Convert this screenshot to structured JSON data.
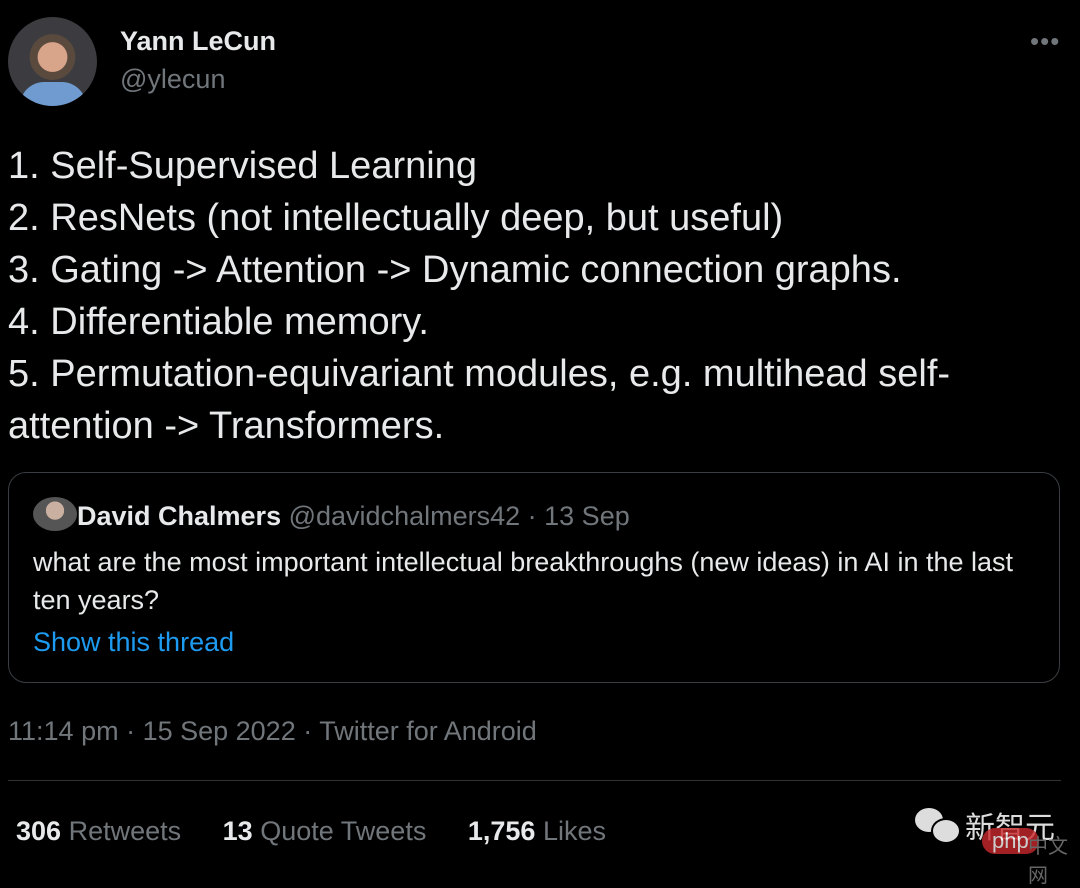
{
  "author": {
    "name": "Yann LeCun",
    "handle": "@ylecun"
  },
  "menu_icon": "more-horizontal-icon",
  "tweet_lines": [
    "1. Self-Supervised Learning",
    "2. ResNets (not intellectually deep, but useful)",
    "3. Gating -> Attention -> Dynamic connection graphs.",
    "4. Differentiable memory.",
    "5. Permutation-equivariant modules, e.g. multihead self-attention -> Transformers."
  ],
  "quoted": {
    "name": "David Chalmers",
    "handle": "@davidchalmers42",
    "date": "· 13 Sep",
    "text": "what are the most important intellectual breakthroughs (new ideas) in AI in the last ten years?",
    "link": "Show this thread"
  },
  "meta": "11:14 pm · 15 Sep 2022 · Twitter for Android",
  "stats": [
    {
      "count": "306",
      "label": "Retweets"
    },
    {
      "count": "13",
      "label": "Quote Tweets"
    },
    {
      "count": "1,756",
      "label": "Likes"
    }
  ],
  "watermark": {
    "wechat": "新智元",
    "php": "php",
    "cn": "中文网"
  },
  "colors": {
    "link": "#1d9bf0",
    "muted": "#71767b",
    "background": "#000000"
  }
}
